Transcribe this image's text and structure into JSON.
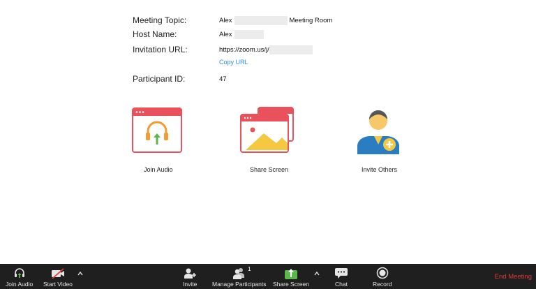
{
  "meeting": {
    "topic_label": "Meeting Topic:",
    "topic_prefix": "Alex",
    "topic_suffix": "Meeting Room",
    "host_label": "Host Name:",
    "host_value": "Alex",
    "url_label": "Invitation URL:",
    "url_value": "https://zoom.us/j/",
    "copy_url": "Copy URL",
    "participant_label": "Participant ID:",
    "participant_value": "47"
  },
  "actions": {
    "join_audio": "Join Audio",
    "share_screen": "Share Screen",
    "invite_others": "Invite Others"
  },
  "toolbar": {
    "join_audio": "Join Audio",
    "start_video": "Start Video",
    "invite": "Invite",
    "manage_participants": "Manage Participants",
    "participant_count": "1",
    "share_screen": "Share Screen",
    "chat": "Chat",
    "record": "Record",
    "end_meeting": "End Meeting"
  },
  "colors": {
    "card_red": "#e9525c",
    "audio_orange": "#f39c33",
    "share_green": "#59b849",
    "link_blue": "#2d8cff",
    "end_red": "#e03a3a",
    "toolbar_bg": "#1f1f1f"
  }
}
